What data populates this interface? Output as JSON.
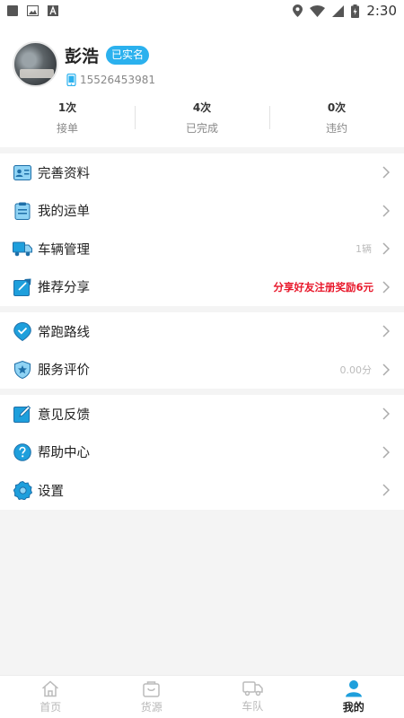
{
  "status_bar": {
    "time": "2:30"
  },
  "profile": {
    "name": "彭浩",
    "badge": "已实名",
    "phone": "15526453981"
  },
  "stats": [
    {
      "value": "1次",
      "label": "接单"
    },
    {
      "value": "4次",
      "label": "已完成"
    },
    {
      "value": "0次",
      "label": "违约"
    }
  ],
  "menu_group_1": [
    {
      "icon": "id-card-icon",
      "label": "完善资料",
      "extra": ""
    },
    {
      "icon": "clipboard-icon",
      "label": "我的运单",
      "extra": ""
    },
    {
      "icon": "truck-icon",
      "label": "车辆管理",
      "extra": "1辆"
    },
    {
      "icon": "share-icon",
      "label": "推荐分享",
      "extra": "分享好友注册奖励6元"
    }
  ],
  "menu_group_2": [
    {
      "icon": "map-pin-icon",
      "label": "常跑路线",
      "extra": ""
    },
    {
      "icon": "rating-icon",
      "label": "服务评价",
      "extra": "0.00分"
    }
  ],
  "menu_group_3": [
    {
      "icon": "feedback-icon",
      "label": "意见反馈",
      "extra": ""
    },
    {
      "icon": "help-icon",
      "label": "帮助中心",
      "extra": ""
    },
    {
      "icon": "settings-icon",
      "label": "设置",
      "extra": ""
    }
  ],
  "tabbar": [
    {
      "icon": "home-icon",
      "label": "首页",
      "active": false
    },
    {
      "icon": "cargo-icon",
      "label": "货源",
      "active": false
    },
    {
      "icon": "fleet-icon",
      "label": "车队",
      "active": false
    },
    {
      "icon": "user-icon",
      "label": "我的",
      "active": true
    }
  ],
  "colors": {
    "accent": "#2bb1ee",
    "highlight": "#e8182b",
    "icon_blue": "#1e9fdc"
  }
}
